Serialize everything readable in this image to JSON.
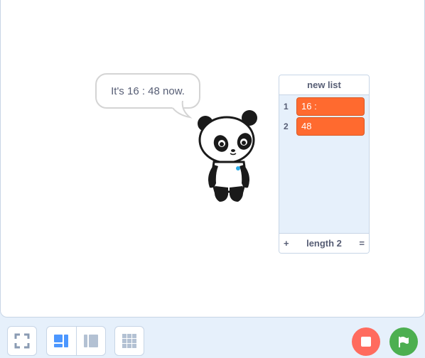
{
  "speech_bubble": {
    "text": "It's 16 : 48 now."
  },
  "list_monitor": {
    "title": "new list",
    "items": [
      {
        "index": "1",
        "value": "16 :"
      },
      {
        "index": "2",
        "value": "48"
      }
    ],
    "footer": {
      "add": "+",
      "length_label": "length 2",
      "resize": "="
    }
  },
  "colors": {
    "accent": "#4c97ff",
    "list_item": "#ff6a2f",
    "stop": "#ff6b5e",
    "green_flag": "#4caf50"
  },
  "toolbar": {
    "fullscreen_icon": "fullscreen-icon",
    "small_stage_icon": "small-stage-layout-icon",
    "large_stage_icon": "large-stage-layout-icon",
    "grid_icon": "grid-icon",
    "stop_icon": "stop-icon",
    "green_flag_icon": "green-flag-icon"
  }
}
